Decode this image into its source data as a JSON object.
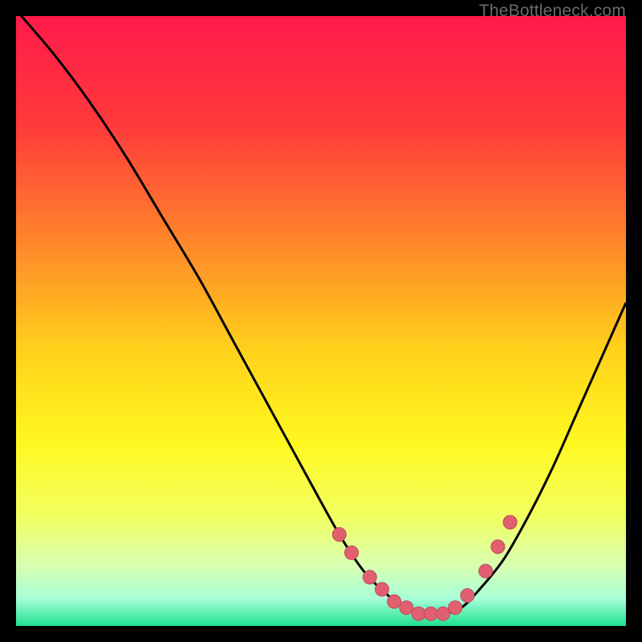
{
  "watermark": "TheBottleneck.com",
  "colors": {
    "bg": "#000000",
    "curve": "#000000",
    "marker_fill": "#e06070",
    "marker_stroke": "#c04a5a"
  },
  "chart_data": {
    "type": "line",
    "title": "",
    "xlabel": "",
    "ylabel": "",
    "xlim": [
      0,
      100
    ],
    "ylim": [
      0,
      100
    ],
    "gradient_stops": [
      {
        "offset": 0.0,
        "color": "#ff1a4b"
      },
      {
        "offset": 0.18,
        "color": "#ff3a3a"
      },
      {
        "offset": 0.38,
        "color": "#ff8a2a"
      },
      {
        "offset": 0.55,
        "color": "#ffd21a"
      },
      {
        "offset": 0.7,
        "color": "#fff820"
      },
      {
        "offset": 0.82,
        "color": "#f2ff60"
      },
      {
        "offset": 0.9,
        "color": "#d8ffb0"
      },
      {
        "offset": 0.955,
        "color": "#a8ffd8"
      },
      {
        "offset": 1.0,
        "color": "#20e090"
      }
    ],
    "series": [
      {
        "name": "bottleneck-curve",
        "x": [
          0,
          6,
          12,
          18,
          24,
          30,
          36,
          42,
          48,
          53,
          57,
          61,
          64,
          67,
          70,
          73,
          76,
          80,
          84,
          88,
          92,
          96,
          100
        ],
        "y": [
          101,
          94,
          86,
          77,
          67,
          57,
          46,
          35,
          24,
          15,
          9,
          5,
          3,
          2,
          2,
          3,
          6,
          11,
          18,
          26,
          35,
          44,
          53
        ]
      }
    ],
    "markers": {
      "name": "highlight-points",
      "x": [
        53,
        55,
        58,
        60,
        62,
        64,
        66,
        68,
        70,
        72,
        74,
        77,
        79,
        81
      ],
      "y": [
        15,
        12,
        8,
        6,
        4,
        3,
        2,
        2,
        2,
        3,
        5,
        9,
        13,
        17
      ]
    }
  }
}
